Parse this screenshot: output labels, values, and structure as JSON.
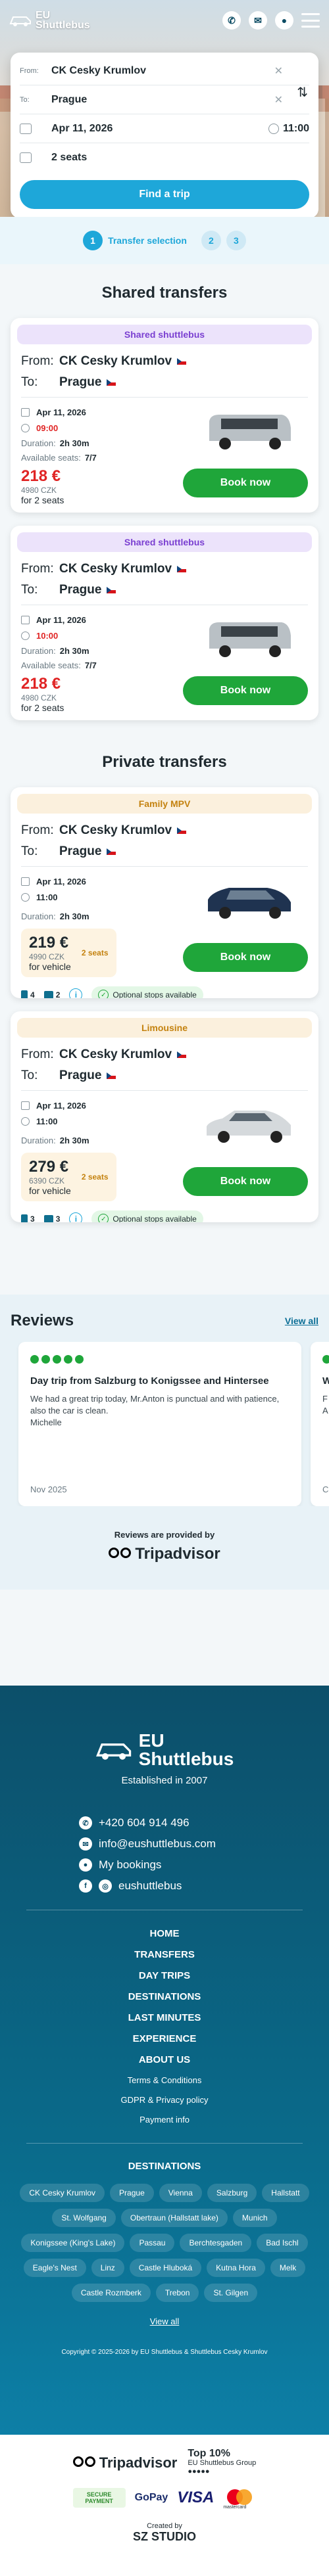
{
  "header": {
    "logo_line1": "EU",
    "logo_line2": "Shuttlebus"
  },
  "search": {
    "from_label": "From:",
    "from_value": "CK Cesky Krumlov",
    "to_label": "To:",
    "to_value": "Prague",
    "date": "Apr 11, 2026",
    "time": "11:00",
    "seats": "2 seats",
    "button": "Find a trip"
  },
  "steps": {
    "s1": "1",
    "s1_label": "Transfer selection",
    "s2": "2",
    "s3": "3"
  },
  "shared": {
    "title": "Shared transfers",
    "cards": [
      {
        "tag": "Shared shuttlebus",
        "from_label": "From:",
        "from": "CK Cesky Krumlov",
        "to_label": "To:",
        "to": "Prague",
        "date": "Apr 11, 2026",
        "time": "09:00",
        "duration_label": "Duration:",
        "duration": "2h 30m",
        "seats_label": "Available seats:",
        "seats": "7/7",
        "price": "218 €",
        "price_czk": "4980 CZK",
        "for": "for 2 seats",
        "book": "Book now"
      },
      {
        "tag": "Shared shuttlebus",
        "from_label": "From:",
        "from": "CK Cesky Krumlov",
        "to_label": "To:",
        "to": "Prague",
        "date": "Apr 11, 2026",
        "time": "10:00",
        "duration_label": "Duration:",
        "duration": "2h 30m",
        "seats_label": "Available seats:",
        "seats": "7/7",
        "price": "218 €",
        "price_czk": "4980 CZK",
        "for": "for 2 seats",
        "book": "Book now"
      }
    ]
  },
  "private": {
    "title": "Private transfers",
    "cards": [
      {
        "tag": "Family MPV",
        "from_label": "From:",
        "from": "CK Cesky Krumlov",
        "to_label": "To:",
        "to": "Prague",
        "date": "Apr 11, 2026",
        "time": "11:00",
        "duration_label": "Duration:",
        "duration": "2h 30m",
        "price": "219 €",
        "price_czk": "4990 CZK",
        "for": "for vehicle",
        "seat_badge": "2 seats",
        "book": "Book now",
        "persons": "4",
        "bags": "2",
        "info": "i",
        "optional": "Optional stops available"
      },
      {
        "tag": "Limousine",
        "from_label": "From:",
        "from": "CK Cesky Krumlov",
        "to_label": "To:",
        "to": "Prague",
        "date": "Apr 11, 2026",
        "time": "11:00",
        "duration_label": "Duration:",
        "duration": "2h 30m",
        "price": "279 €",
        "price_czk": "6390 CZK",
        "for": "for vehicle",
        "seat_badge": "2 seats",
        "book": "Book now",
        "persons": "3",
        "bags": "3",
        "info": "i",
        "optional": "Optional stops available"
      }
    ]
  },
  "reviews": {
    "title": "Reviews",
    "view_all": "View all",
    "items": [
      {
        "title": "Day trip from Salzburg to Konigssee and Hintersee",
        "text": "We had a great trip today, Mr.Anton is punctual and with patience, also the car is clean.",
        "author": "Michelle",
        "date": "Nov 2025"
      },
      {
        "title": "W",
        "text": "F\nA",
        "date": "C"
      }
    ],
    "provided_by": "Reviews are provided by",
    "provider": "Tripadvisor"
  },
  "footer": {
    "logo_line1": "EU",
    "logo_line2": "Shuttlebus",
    "established": "Established in 2007",
    "phone": "+420 604 914 496",
    "email": "info@eushuttlebus.com",
    "bookings": "My bookings",
    "social_handle": "eushuttlebus",
    "nav_main": [
      "HOME",
      "TRANSFERS",
      "DAY TRIPS",
      "DESTINATIONS",
      "LAST MINUTES",
      "EXPERIENCE",
      "ABOUT US"
    ],
    "nav_sub": [
      "Terms & Conditions",
      "GDPR & Privacy policy",
      "Payment info"
    ],
    "destinations_title": "DESTINATIONS",
    "destinations": [
      "CK Cesky Krumlov",
      "Prague",
      "Vienna",
      "Salzburg",
      "Hallstatt",
      "St. Wolfgang",
      "Obertraun (Hallstatt lake)",
      "Munich",
      "Konigssee (King's Lake)",
      "Passau",
      "Berchtesgaden",
      "Bad Ischl",
      "Eagle's Nest",
      "Linz",
      "Castle Hluboká",
      "Kutna Hora",
      "Melk",
      "Castle Rozmberk",
      "Trebon",
      "St. Gilgen"
    ],
    "view_all": "View all",
    "copyright": "Copyright © 2025-2026 by EU Shuttlebus & Shuttlebus Cesky Krumlov"
  },
  "badges": {
    "tripadvisor": "Tripadvisor",
    "top10": "Top 10%",
    "top10_sub": "EU Shuttlebus Group",
    "secure": "SECURE PAYMENT",
    "gopay": "GoPay",
    "visa": "VISA",
    "mastercard": "mastercard",
    "created_by": "Created by",
    "studio": "SZ STUDIO"
  },
  "colors": {
    "accent": "#1ea7d9",
    "book": "#1fa63a",
    "price": "#e02424",
    "footer": "#0c4f6a"
  }
}
